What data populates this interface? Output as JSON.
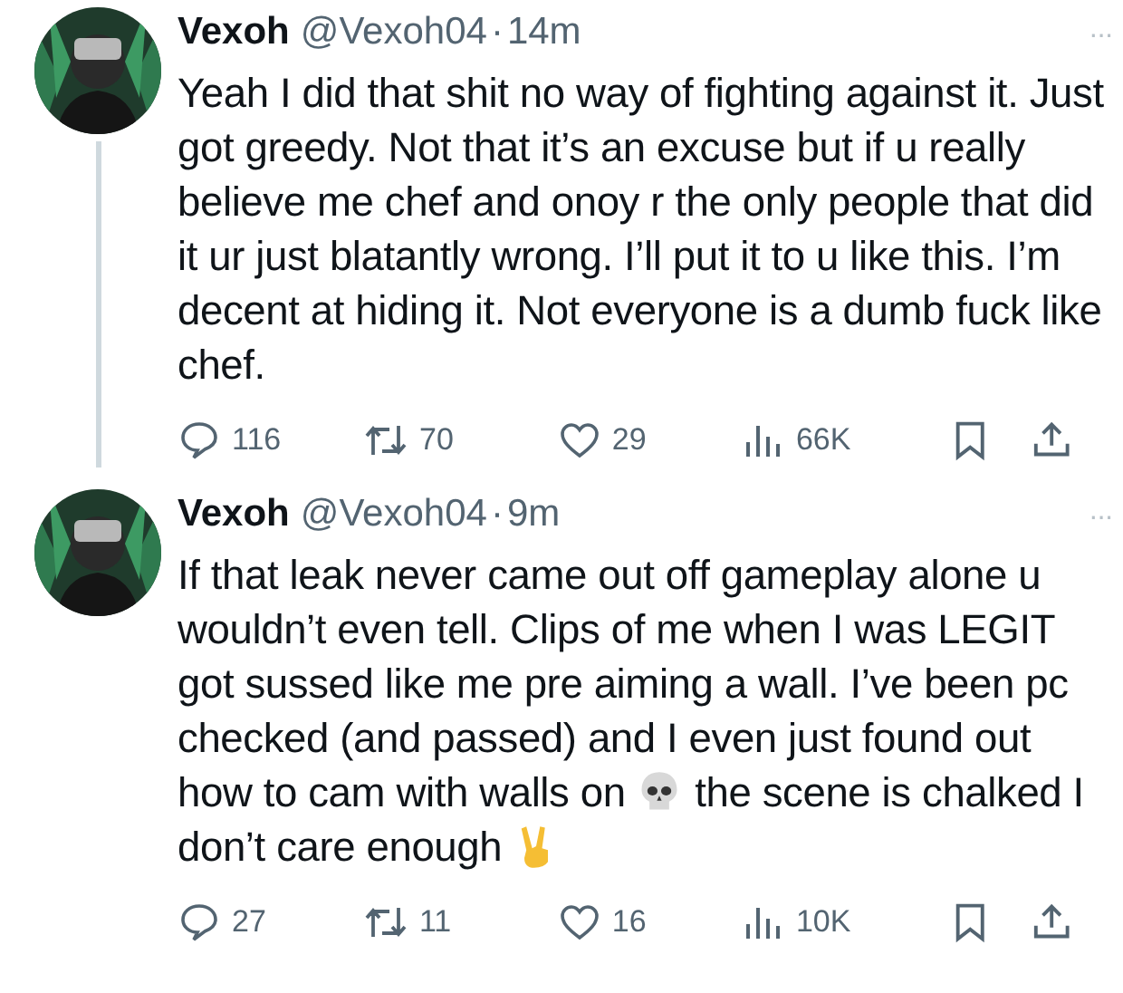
{
  "tweets": [
    {
      "name": "Vexoh",
      "handle": "@Vexoh04",
      "separator": "·",
      "time": "14m",
      "more": "···",
      "thread_line": true,
      "body": [
        {
          "kind": "text",
          "text": "Yeah I did that shit no way of fighting against it. Just got greedy. Not that it’s an excuse but if u really believe me chef and onoy r the only people that did it ur just blatantly wrong. I’ll put it to u like this. I’m decent at hiding it. Not everyone is a dumb fuck like chef."
        }
      ],
      "replies": "116",
      "reposts": "70",
      "likes": "29",
      "views": "66K"
    },
    {
      "name": "Vexoh",
      "handle": "@Vexoh04",
      "separator": "·",
      "time": "9m",
      "more": "···",
      "thread_line": false,
      "body": [
        {
          "kind": "text",
          "text": "If that leak never came out off gameplay alone u wouldn’t even tell. Clips of me when I was LEGIT got sussed like me pre aiming a wall. I’ve been pc checked (and passed) and I even just found out how to cam with walls on "
        },
        {
          "kind": "skull"
        },
        {
          "kind": "text",
          "text": " the scene is chalked I don’t care enough "
        },
        {
          "kind": "peace"
        }
      ],
      "replies": "27",
      "reposts": "11",
      "likes": "16",
      "views": "10K"
    }
  ]
}
